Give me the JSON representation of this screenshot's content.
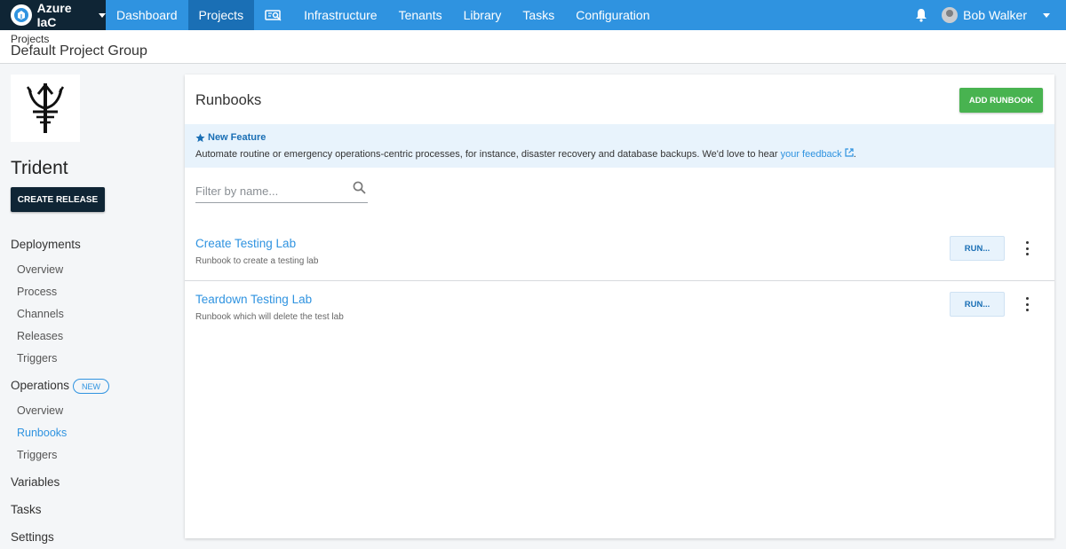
{
  "topnav": {
    "space_name": "Azure IaC",
    "items": [
      "Dashboard",
      "Projects",
      "Infrastructure",
      "Tenants",
      "Library",
      "Tasks",
      "Configuration"
    ],
    "user_name": "Bob Walker"
  },
  "header": {
    "breadcrumb": "Projects",
    "title": "Default Project Group"
  },
  "sidebar": {
    "project_name": "Trident",
    "create_release": "CREATE RELEASE",
    "deployments": {
      "label": "Deployments",
      "items": [
        "Overview",
        "Process",
        "Channels",
        "Releases",
        "Triggers"
      ]
    },
    "operations": {
      "label": "Operations",
      "badge": "NEW",
      "items": [
        "Overview",
        "Runbooks",
        "Triggers"
      ],
      "active": "Runbooks"
    },
    "variables": "Variables",
    "tasks": "Tasks",
    "settings": "Settings"
  },
  "main": {
    "title": "Runbooks",
    "add_button": "ADD RUNBOOK",
    "callout": {
      "title": "New Feature",
      "text": "Automate routine or emergency operations-centric processes, for instance, disaster recovery and database backups. We'd love to hear ",
      "link": "your feedback",
      "end": "."
    },
    "filter_placeholder": "Filter by name...",
    "runbooks": [
      {
        "name": "Create Testing Lab",
        "description": "Runbook to create a testing lab",
        "run_label": "RUN..."
      },
      {
        "name": "Teardown Testing Lab",
        "description": "Runbook which will delete the test lab",
        "run_label": "RUN..."
      }
    ]
  },
  "colors": {
    "nav_blue": "#2f93e0",
    "nav_active": "#1a6fb5",
    "dark_navy": "#0f2535",
    "add_green": "#48b350",
    "callout_bg": "#e8f3fc"
  },
  "icons": [
    "octopus-logo-icon",
    "chevron-down-icon",
    "infrastructure-icon",
    "bell-icon",
    "trident-logo-icon",
    "star-icon",
    "external-link-icon",
    "search-icon",
    "more-vert-icon"
  ]
}
